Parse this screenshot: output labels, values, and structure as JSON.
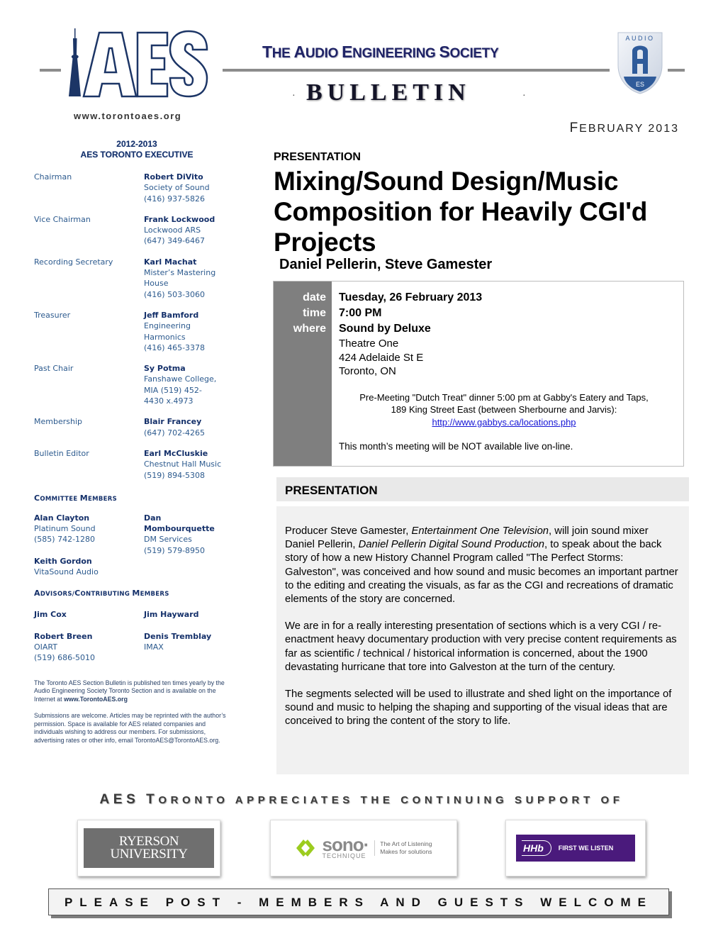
{
  "header": {
    "logo_text": "AES",
    "website": "www.torontoaes.org",
    "society_name": {
      "word1_initial": "T",
      "word1_rest": "HE ",
      "word2_initial": "A",
      "word2_rest": "UDIO ",
      "word3_initial": "E",
      "word3_rest": "NGINEERING ",
      "word4_initial": "S",
      "word4_rest": "OCIETY"
    },
    "publication": "BULLETIN",
    "bullet": "·",
    "badge_top": "AUDIO",
    "badge_letter": "A",
    "badge_bottom": "ES",
    "issue_month_initial": "F",
    "issue_month_rest": "EBRUARY",
    "issue_year": "2013",
    "colors": {
      "navy": "#1f2366",
      "rule_gray": "#8c8c8c",
      "badge_blue": "#2f5b9a"
    }
  },
  "sidebar": {
    "term": "2012-2013",
    "exec_title": "AES TORONTO EXECUTIVE",
    "officers": [
      {
        "role": "Chairman",
        "name": "Robert DiVito",
        "details": [
          "Society of Sound",
          "(416) 937-5826"
        ]
      },
      {
        "role": "Vice Chairman",
        "name": "Frank Lockwood",
        "details": [
          "Lockwood ARS",
          "(647) 349-6467"
        ]
      },
      {
        "role": "Recording Secretary",
        "name": "Karl Machat",
        "details": [
          "Mister’s Mastering",
          "House",
          "(416) 503-3060"
        ]
      },
      {
        "role": "Treasurer",
        "name": "Jeff Bamford",
        "details": [
          "Engineering",
          "Harmonics",
          "(416) 465-3378"
        ]
      },
      {
        "role": "Past Chair",
        "name": "Sy Potma",
        "details": [
          "Fanshawe College,",
          "MIA (519) 452-",
          "4430 x.4973"
        ]
      },
      {
        "role": "Membership",
        "name": "Blair Francey",
        "details": [
          "(647) 702-4265"
        ]
      },
      {
        "role": "Bulletin Editor",
        "name": "Earl McCluskie",
        "details": [
          "Chestnut Hall Music",
          "(519) 894-5308"
        ]
      }
    ],
    "committee_title": {
      "c1": "C",
      "r1": "OMMITTEE ",
      "c2": "M",
      "r2": "EMBERS"
    },
    "committee": [
      {
        "name": "Alan Clayton",
        "details": [
          "Platinum Sound",
          "(585) 742-1280"
        ]
      },
      {
        "name": "Dan Mombourquette",
        "name_lines": [
          "Dan",
          "Mombourquette"
        ],
        "details": [
          "DM Services",
          "(519) 579-8950"
        ]
      },
      {
        "name": "Keith Gordon",
        "details": [
          "VitaSound Audio"
        ]
      }
    ],
    "advisors_title": {
      "c1": "A",
      "r1": "DVISORS/",
      "c2": "C",
      "r2": "ONTRIBUTING ",
      "c3": "M",
      "r3": "EMBERS"
    },
    "advisors": [
      {
        "name": "Jim Cox",
        "details": []
      },
      {
        "name": "Jim Hayward",
        "details": []
      },
      {
        "name": "Robert Breen",
        "details": [
          "OIART",
          "(519) 686-5010"
        ]
      },
      {
        "name": "Denis Tremblay",
        "details": [
          "IMAX"
        ]
      }
    ],
    "footnote1_text": "The Toronto AES Section Bulletin is published ten times yearly by the Audio Engineering Society Toronto Section and is available on the Internet at ",
    "footnote1_link": "www.TorontoAES.org",
    "footnote2": "Submissions are welcome. Articles may be reprinted with the author’s permission.  Space is available for AES related companies and individuals wishing to address our members. For submissions, advertising rates or other info, email TorontoAES@TorontoAES.org."
  },
  "main": {
    "section_label": "PRESENTATION",
    "title": "Mixing/Sound Design/Music Composition for Heavily CGI'd Projects",
    "speakers": "Daniel Pellerin, Steve Gamester",
    "event": {
      "labels": {
        "date": "date",
        "time": "time",
        "where": "where"
      },
      "date": "Tuesday, 26 February 2013",
      "time": "7:00 PM",
      "venue": "Sound by Deluxe",
      "address": [
        "Theatre One",
        "424 Adelaide St E",
        "Toronto, ON"
      ],
      "premeeting_line1": "Pre-Meeting \"Dutch Treat\" dinner 5:00 pm at Gabby's Eatery and Taps,",
      "premeeting_line2": "189 King Street East (between Sherbourne and Jarvis):",
      "premeeting_link": "http://www.gabbys.ca/locations.php",
      "notice": "This month’s meeting will be NOT available live on-line."
    },
    "presentation_header": "PRESENTATION",
    "paragraphs": {
      "p1_a": "Producer Steve Gamester, ",
      "p1_em1": "Entertainment One Television",
      "p1_b": ", will join sound mixer Daniel Pellerin, ",
      "p1_em2": "Daniel Pellerin Digital Sound Production",
      "p1_c": ", to speak about the back story of how a new History Channel Program called \"The Perfect Storms: Galveston\", was conceived and how sound and music becomes an important partner to the editing and creating the visuals, as far as the CGI and recreations of dramatic elements of the story are concerned.",
      "p2": "We are in for a really interesting presentation of sections which is a very CGI / re-enactment  heavy documentary production with very precise content requirements as far as scientific / technical / historical information is concerned, about the 1900 devastating hurricane that tore into Galveston at the turn of the century.",
      "p3": "The segments selected will be used to illustrate and shed light on the importance of sound and music to helping the shaping and supporting of the visual ideas that are conceived to bring the content of the story to life."
    }
  },
  "sponsors": {
    "heading_big1": "AES",
    "heading_big2": "T",
    "heading_rest": "ORONTO APPRECIATES THE CONTINUING SUPPORT OF",
    "ryerson": {
      "line1": "RYERSON",
      "line2": "UNIVERSITY"
    },
    "sono": {
      "word": "sono·",
      "sub": "TECHNIQUE",
      "tag1": "The Art of Listening",
      "tag2": "Makes for solutions"
    },
    "hhb": {
      "mark": "HHb",
      "tagline": "FIRST WE LISTEN"
    }
  },
  "footer": {
    "banner": "PLEASE POST - MEMBERS AND GUESTS WELCOME"
  }
}
